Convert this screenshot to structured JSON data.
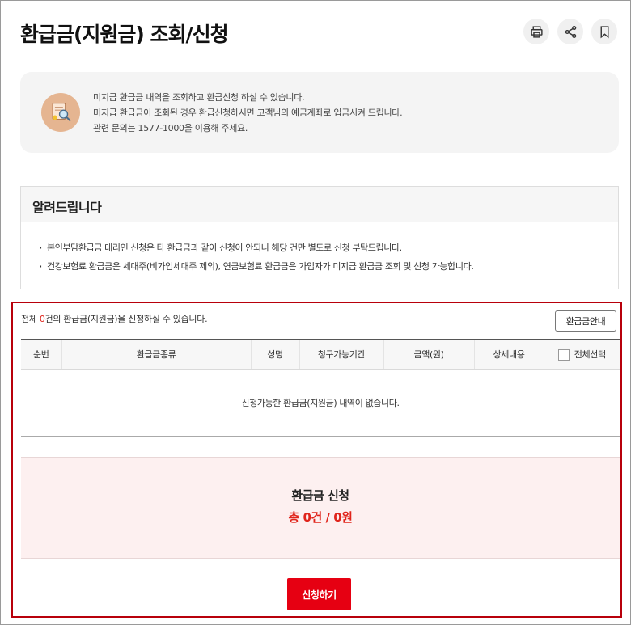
{
  "page": {
    "title": "환급금(지원금) 조회/신청",
    "icons": [
      "print-icon",
      "share-icon",
      "bookmark-icon"
    ]
  },
  "info": {
    "icon": "search-document-icon",
    "lines": [
      "미지급 환급금 내역을 조회하고 환급신청 하실 수 있습니다.",
      "미지급 환급금이 조회된 경우 환급신청하시면 고객님의 예금계좌로 입금시켜 드립니다.",
      "관련 문의는 1577-1000을 이용해 주세요."
    ]
  },
  "notice": {
    "title": "알려드립니다",
    "items": [
      "본인부담환급금 대리인 신청은 타 환급금과 같이 신청이 안되니 해당 건만 별도로 신청 부탁드립니다.",
      "건강보험료 환급금은 세대주(비가입세대주 제외), 연금보험료 환급금은 가입자가 미지급 환급금 조회 및 신청 가능합니다."
    ]
  },
  "refund": {
    "count_prefix": "전체 ",
    "count": "0",
    "count_suffix": "건의 환급금(지원금)을 신청하실 수 있습니다.",
    "guide_button": "환급금안내",
    "columns": [
      "순번",
      "환급금종류",
      "성명",
      "청구가능기간",
      "금액(원)",
      "상세내용",
      "전체선택"
    ],
    "empty_message": "신청가능한 환급금(지원금) 내역이 없습니다.",
    "summary_title": "환급금 신청",
    "summary_total": "총 0건 / 0원",
    "apply_button": "신청하기"
  },
  "colors": {
    "accent_red": "#e60012",
    "highlight_border": "#b8000b",
    "summary_bg": "#fdf0f0"
  }
}
